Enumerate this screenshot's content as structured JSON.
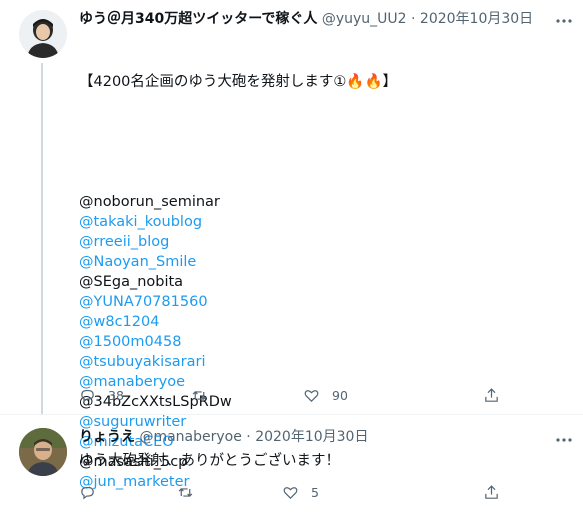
{
  "tweets": [
    {
      "name": "ゆう＠月340万超ツイッターで稼ぐ人",
      "handle": "@yuyu_UU2",
      "separator": "·",
      "date": "2020年10月30日",
      "headline": "【4200名企画のゆう大砲を発射します①🔥🔥】",
      "mentions": [
        {
          "text": "@noborun_seminar",
          "link": false
        },
        {
          "text": "@takaki_koublog",
          "link": true
        },
        {
          "text": "@rreeii_blog",
          "link": true
        },
        {
          "text": "@Naoyan_Smile",
          "link": true
        },
        {
          "text": "@SEga_nobita",
          "link": false
        },
        {
          "text": "@YUNA70781560",
          "link": true
        },
        {
          "text": "@w8c1204",
          "link": true
        },
        {
          "text": "@1500m0458",
          "link": true
        },
        {
          "text": "@tsubuyakisarari",
          "link": true
        },
        {
          "text": "@manaberyoe",
          "link": true
        },
        {
          "text": "@34bZcXXtsLSpRDw",
          "link": false
        },
        {
          "text": "@suguruwriter",
          "link": true
        },
        {
          "text": "@mizutaCEO",
          "link": true
        },
        {
          "text": "@masashi_5cp",
          "link": false
        },
        {
          "text": "@jun_marketer",
          "link": true
        }
      ],
      "counts": {
        "reply": "38",
        "retweet": "",
        "like": "90"
      }
    },
    {
      "name": "りょうえ",
      "handle": "@manaberyoe",
      "separator": "·",
      "date": "2020年10月30日",
      "text": "ゆう大砲発射、ありがとうございます！",
      "counts": {
        "reply": "",
        "retweet": "",
        "like": "5"
      }
    }
  ],
  "colors": {
    "link": "#1d9bf0",
    "text": "#0f1419",
    "muted": "#536471",
    "line": "#cfd9de"
  },
  "icons": [
    "more-icon",
    "reply-icon",
    "retweet-icon",
    "like-icon",
    "share-icon"
  ]
}
